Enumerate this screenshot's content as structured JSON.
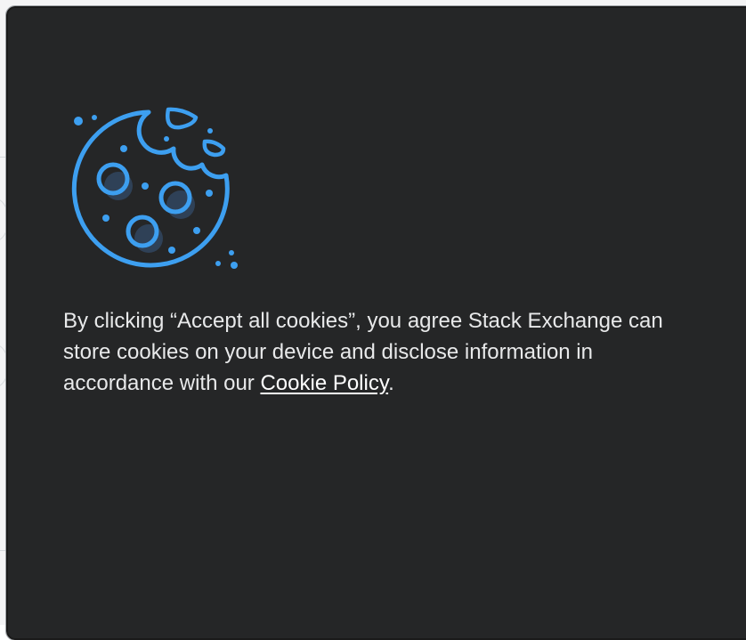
{
  "cookie_banner": {
    "message_before_link": "By clicking “Accept all cookies”, you agree Stack Exchange can store cookies on your device and disclose information in accordance with our ",
    "policy_link_label": "Cookie Policy",
    "message_after_link": ".",
    "illustration_icon": "cookie-icon"
  },
  "colors": {
    "dialog_background": "#252627",
    "icon_stroke": "#3d9ff0",
    "text": "#e8e9ea"
  }
}
